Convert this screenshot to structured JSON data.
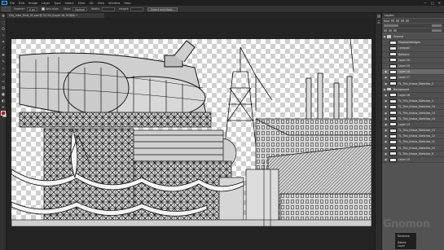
{
  "menubar": {
    "app_icon": "photoshop-logo",
    "items": [
      "File",
      "Edit",
      "Image",
      "Layer",
      "Type",
      "Select",
      "Filter",
      "3D",
      "View",
      "Window",
      "Help"
    ],
    "window_controls": [
      "—",
      "□",
      "✕"
    ]
  },
  "optionsbar": {
    "feather_label": "Feather:",
    "feather_value": "0 px",
    "antialias_label": "Anti-alias",
    "style_label": "Style:",
    "style_value": "Normal",
    "width_label": "Width:",
    "height_label": "Height:",
    "refine_button": "Select and Mask..."
  },
  "document_tab": "City_Intro_Final_01.psd @ 33.3% (Layer 18, RGB/8) *",
  "colors": {
    "foreground": "#d0021b",
    "background": "#ffffff"
  },
  "tools": [
    "move-tool",
    "marquee-tool",
    "lasso-tool",
    "magic-wand-tool",
    "crop-tool",
    "eyedropper-tool",
    "healing-tool",
    "brush-tool",
    "stamp-tool",
    "history-brush-tool",
    "eraser-tool",
    "gradient-tool",
    "blur-tool",
    "dodge-tool",
    "pen-tool",
    "type-tool",
    "path-select-tool",
    "shape-tool",
    "hand-tool",
    "zoom-tool"
  ],
  "layers_panel": {
    "title": "Layers",
    "filter_label": "Kind",
    "layers": [
      {
        "name": "Ground",
        "type": "folder",
        "visible": true
      },
      {
        "name": "Magicpilebridges",
        "type": "layer",
        "visible": false
      },
      {
        "name": "Lampost",
        "type": "layer",
        "visible": false
      },
      {
        "name": "Balloons",
        "type": "layer",
        "visible": false
      },
      {
        "name": "Layer 20",
        "type": "layer",
        "visible": false
      },
      {
        "name": "Layer 19",
        "type": "layer",
        "visible": false
      },
      {
        "name": "Layer 18",
        "type": "layer",
        "visible": true,
        "selected": true
      },
      {
        "name": "Layer 17",
        "type": "layer",
        "visible": true
      },
      {
        "name": "TL_This_Ithaca_Sketches_3",
        "type": "layer",
        "visible": true
      },
      {
        "name": "Background",
        "type": "folder",
        "visible": true
      },
      {
        "name": "Layer 16",
        "type": "layer",
        "visible": true
      },
      {
        "name": "TL_This_Ithaca_Sketches_4",
        "type": "layer",
        "visible": true
      },
      {
        "name": "TL_This_Ithaca_Sketches_16",
        "type": "layer",
        "visible": true
      },
      {
        "name": "TL_This_Ithaca_Sketches_15",
        "type": "layer",
        "visible": true
      },
      {
        "name": "TL_This_Ithaca_Sketches_14",
        "type": "layer",
        "visible": true
      },
      {
        "name": "Layer 13",
        "type": "layer",
        "visible": true
      },
      {
        "name": "TL_This_Ithaca_Sketches_13",
        "type": "layer",
        "visible": true
      },
      {
        "name": "TL_This_Ithaca_Sketches_12",
        "type": "layer",
        "visible": true
      },
      {
        "name": "TL_This_Ithaca_Sketches_11",
        "type": "layer",
        "visible": true
      },
      {
        "name": "TL_This_Ithaca_Sketches_10",
        "type": "layer",
        "visible": true
      },
      {
        "name": "TL_This_Ithaca_Sketches_9",
        "type": "layer",
        "visible": true
      },
      {
        "name": "Layer 10",
        "type": "layer",
        "visible": true
      }
    ]
  },
  "context_popup": [
    "Rasterize",
    "Delete Layer"
  ],
  "watermark": "Gnomon"
}
